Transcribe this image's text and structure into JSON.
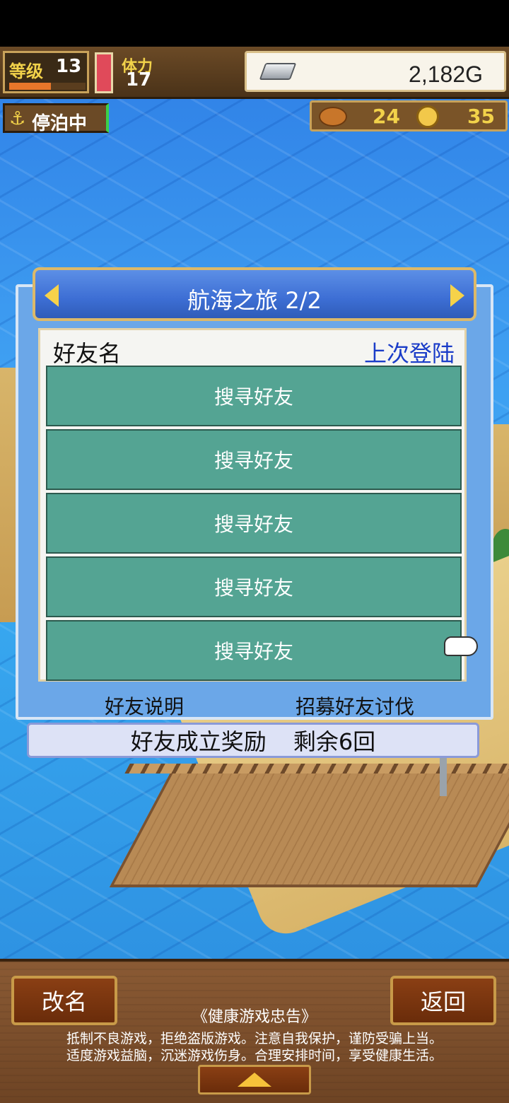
{
  "hud": {
    "level_label": "等级",
    "level": "13",
    "exp_fraction": 0.55,
    "stamina_label": "体力",
    "stamina": "17",
    "stamina_fraction": 1.0,
    "gold": "2,182G",
    "harbor_status": "停泊中",
    "food_count": "24",
    "coin_count": "35"
  },
  "dialog": {
    "title": "航海之旅 2/2",
    "col_friend": "好友名",
    "col_last_login": "上次登陆",
    "slots": [
      "搜寻好友",
      "搜寻好友",
      "搜寻好友",
      "搜寻好友",
      "搜寻好友"
    ],
    "link_help": "好友说明",
    "link_recruit": "招募好友讨伐",
    "reward_label": "好友成立奖励",
    "reward_remaining": "剩余6回"
  },
  "bottom": {
    "rename_label": "改名",
    "back_label": "返回",
    "advice_title": "《健康游戏忠告》",
    "advice_line1": "抵制不良游戏，拒绝盗版游戏。注意自我保护，谨防受骗上当。",
    "advice_line2": "适度游戏益脑，沉迷游戏伤身。合理安排时间，享受健康生活。"
  },
  "icons": {
    "anchor": "anchor-icon",
    "silver": "silver-bar-icon",
    "food": "bread-icon",
    "coin": "coin-icon",
    "pointer": "pointing-hand-icon"
  },
  "colors": {
    "dialog_bg": "#6ba7e8",
    "title_bar": "#3d6ed4",
    "friend_slot": "#54a493",
    "last_login_text": "#1a3cc8",
    "hud_yellow": "#f2d24a"
  }
}
